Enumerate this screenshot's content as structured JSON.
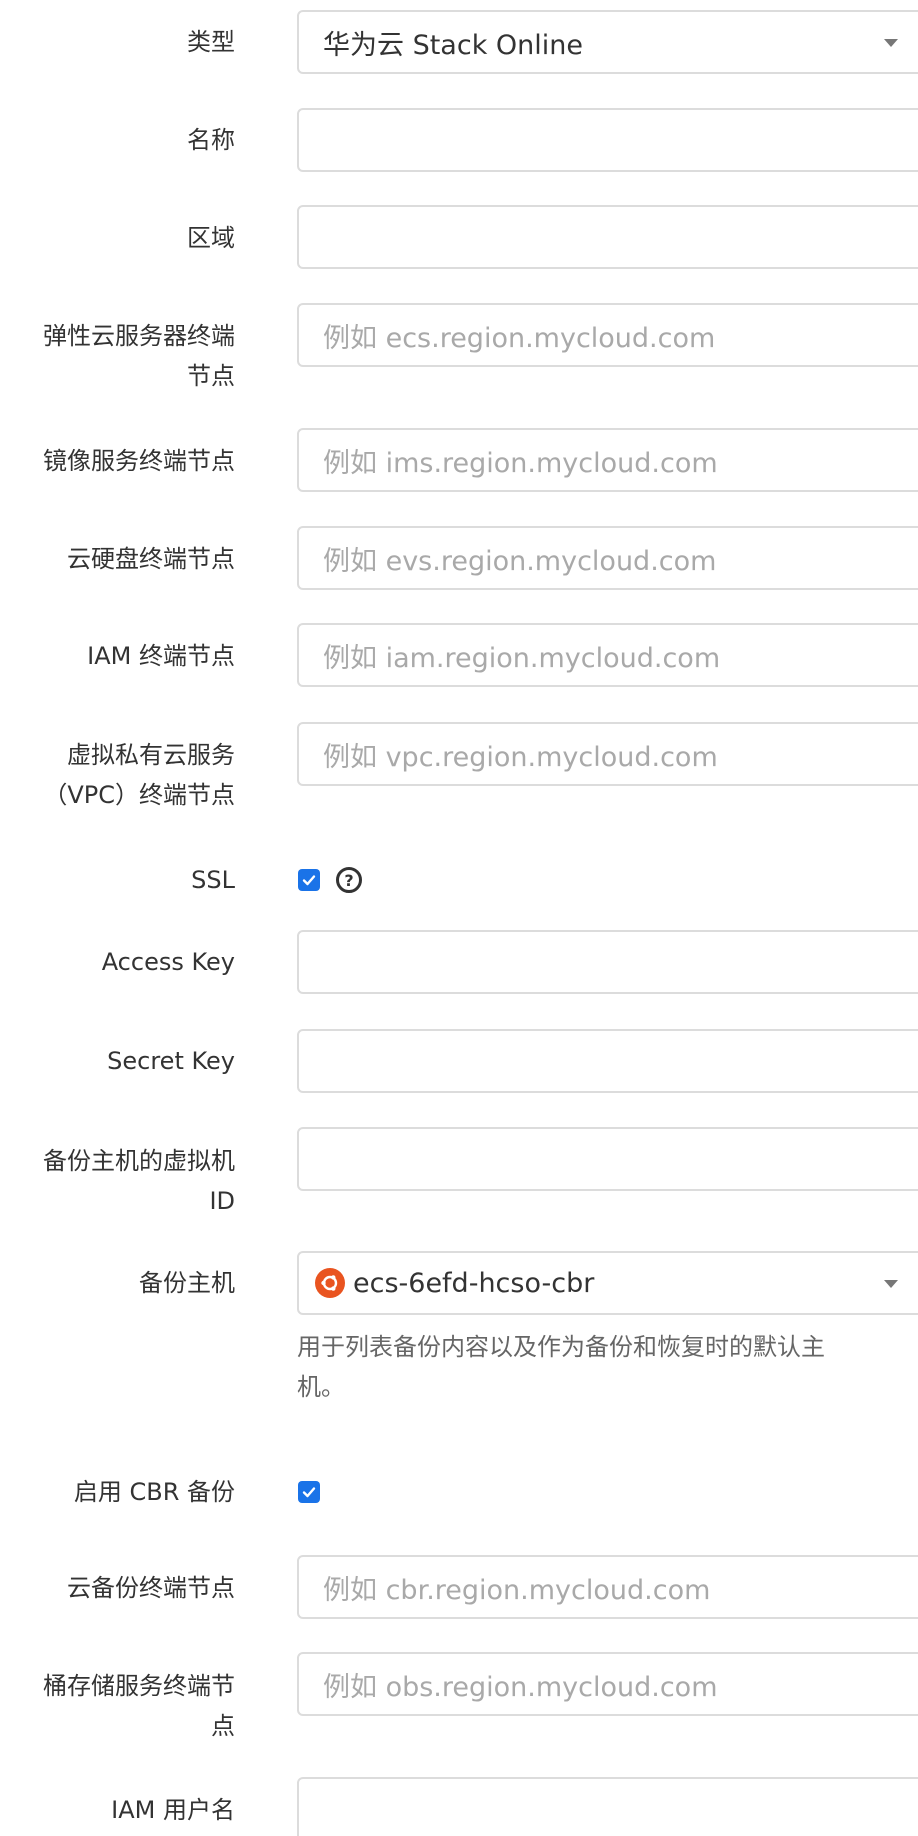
{
  "form": {
    "type": {
      "label": "类型",
      "value": "华为云 Stack Online"
    },
    "name": {
      "label": "名称",
      "value": ""
    },
    "region": {
      "label": "区域",
      "value": ""
    },
    "ecs_endpoint": {
      "label_line1": "弹性云服务器终端",
      "label_line2": "节点",
      "placeholder": "例如 ecs.region.mycloud.com"
    },
    "ims_endpoint": {
      "label": "镜像服务终端节点",
      "placeholder": "例如 ims.region.mycloud.com"
    },
    "evs_endpoint": {
      "label": "云硬盘终端节点",
      "placeholder": "例如 evs.region.mycloud.com"
    },
    "iam_endpoint": {
      "label": "IAM 终端节点",
      "placeholder": "例如 iam.region.mycloud.com"
    },
    "vpc_endpoint": {
      "label_line1": "虚拟私有云服务",
      "label_line2": "（VPC）终端节点",
      "placeholder": "例如 vpc.region.mycloud.com"
    },
    "ssl": {
      "label": "SSL",
      "checked": true,
      "help_glyph": "?"
    },
    "access_key": {
      "label": "Access Key",
      "value": ""
    },
    "secret_key": {
      "label": "Secret Key",
      "value": ""
    },
    "backup_vm_id": {
      "label_line1": "备份主机的虚拟机",
      "label_line2": "ID",
      "value": ""
    },
    "backup_host": {
      "label": "备份主机",
      "value": "ecs-6efd-hcso-cbr",
      "icon": "ubuntu-icon",
      "hint_line1": "用于列表备份内容以及作为备份和恢复时的默认主",
      "hint_line2": "机。"
    },
    "enable_cbr": {
      "label": "启用 CBR 备份",
      "checked": true
    },
    "cbr_endpoint": {
      "label": "云备份终端节点",
      "placeholder": "例如 cbr.region.mycloud.com"
    },
    "obs_endpoint": {
      "label_line1": "桶存储服务终端节",
      "label_line2": "点",
      "placeholder": "例如 obs.region.mycloud.com"
    },
    "iam_username": {
      "label": "IAM 用户名",
      "value": ""
    }
  },
  "colors": {
    "accent": "#1a73e8",
    "border": "#dcdcdc",
    "placeholder": "#a9a9a9",
    "ubuntu": "#e95420"
  }
}
